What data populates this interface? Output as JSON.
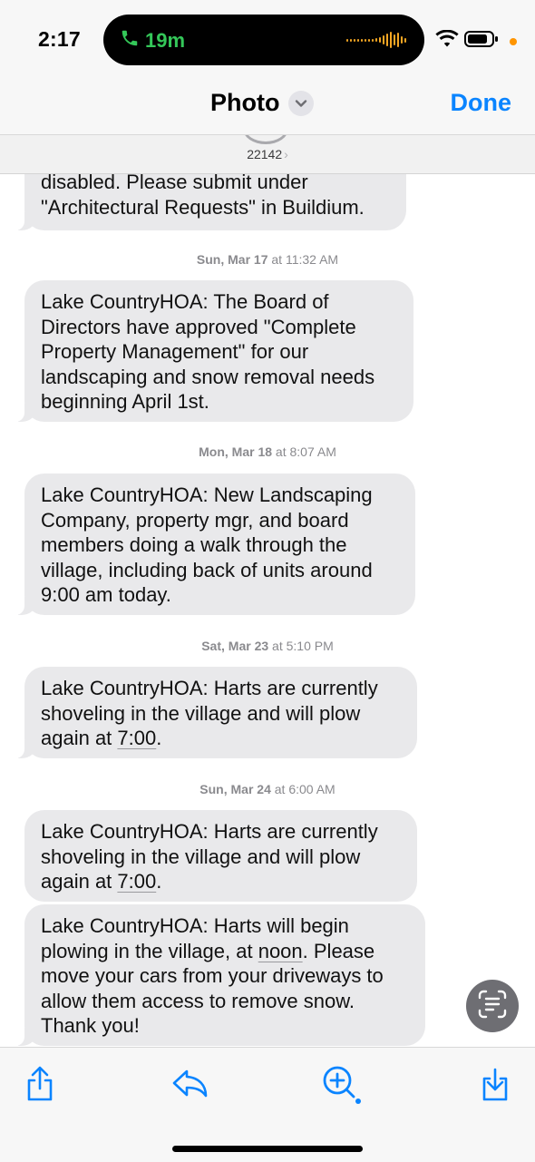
{
  "status_bar": {
    "time": "2:17",
    "call_duration": "19m"
  },
  "nav": {
    "title": "Photo",
    "done_label": "Done",
    "sender": "22142",
    "sender_chevron": "›"
  },
  "messages": [
    {
      "type": "bubble",
      "text": "disabled. Please submit under \"Architectural Requests\" in  Buildium."
    },
    {
      "type": "timestamp",
      "day": "Sun, Mar 17",
      "at": "at",
      "time": "11:32 AM"
    },
    {
      "type": "bubble",
      "text": "Lake CountryHOA: The Board of Directors have approved \"Complete Property Management\" for our landscaping and snow removal needs beginning April 1st."
    },
    {
      "type": "timestamp",
      "day": "Mon, Mar 18",
      "at": "at",
      "time": "8:07 AM"
    },
    {
      "type": "bubble",
      "text": "Lake CountryHOA: New Landscaping Company, property mgr, and board members doing a walk through the village, including back of units around 9:00 am today."
    },
    {
      "type": "timestamp",
      "day": "Sat, Mar 23",
      "at": "at",
      "time": "5:10 PM"
    },
    {
      "type": "bubble",
      "text_before": "Lake CountryHOA: Harts are currently shoveling in the village and will plow again at ",
      "link": "7:00",
      "text_after": "."
    },
    {
      "type": "timestamp",
      "day": "Sun, Mar 24",
      "at": "at",
      "time": "6:00 AM"
    },
    {
      "type": "bubble",
      "text_before": "Lake CountryHOA: Harts are currently shoveling in the village and will plow again at ",
      "link": "7:00",
      "text_after": "."
    },
    {
      "type": "bubble",
      "text_before": "Lake CountryHOA: Harts will begin plowing in the village, at ",
      "link": "noon",
      "text_after": ".  Please move your cars from your driveways to allow them access to remove snow. Thank you!"
    }
  ],
  "icons": {
    "phone": "phone-icon",
    "wifi": "wifi-icon",
    "battery": "battery-icon",
    "chevron_down": "chevron-down-icon",
    "live_text": "live-text-icon",
    "share": "share-icon",
    "reply": "reply-icon",
    "lookup": "visual-lookup-icon",
    "save": "save-icon"
  },
  "colors": {
    "accent": "#0a84ff",
    "call_green": "#34c759",
    "bubble": "#e9e9eb",
    "timestamp": "#8a8a8e"
  }
}
